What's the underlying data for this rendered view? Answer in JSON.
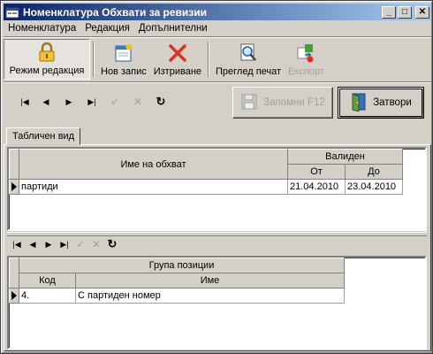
{
  "window": {
    "title": "Номенклатура Обхвати за ревизии",
    "minimize_glyph": "_",
    "maximize_glyph": "□",
    "close_glyph": "✕"
  },
  "menu": [
    "Номенклатура",
    "Редакция",
    "Допълнителни"
  ],
  "toolbar": {
    "edit_mode": "Режим редакция",
    "new_record": "Нов запис",
    "delete": "Изтриване",
    "print_preview": "Преглед печат",
    "export": "Експорт"
  },
  "nav_glyphs": {
    "first": "|◀",
    "prior": "◀",
    "next": "▶",
    "last": "▶|",
    "post": "✓",
    "cancel": "✕",
    "refresh": "↻"
  },
  "buttons": {
    "save": "Запомни  F12",
    "close": "Затвори"
  },
  "tab": {
    "label": "Табличен вид"
  },
  "main_grid": {
    "col_name": "Име на обхват",
    "group_valid": "Валиден",
    "col_from": "От",
    "col_to": "До",
    "rows": [
      {
        "name": "партиди",
        "from": "21.04.2010",
        "to": "23.04.2010"
      }
    ]
  },
  "detail_grid": {
    "group_title": "Група позиции",
    "col_code": "Код",
    "col_name": "Име",
    "rows": [
      {
        "code": "4.",
        "name": "С партиден номер"
      }
    ]
  },
  "colors": {
    "title_start": "#0a246a",
    "title_end": "#a6caf0",
    "face": "#d4d0c8",
    "delete_red": "#e03020"
  }
}
